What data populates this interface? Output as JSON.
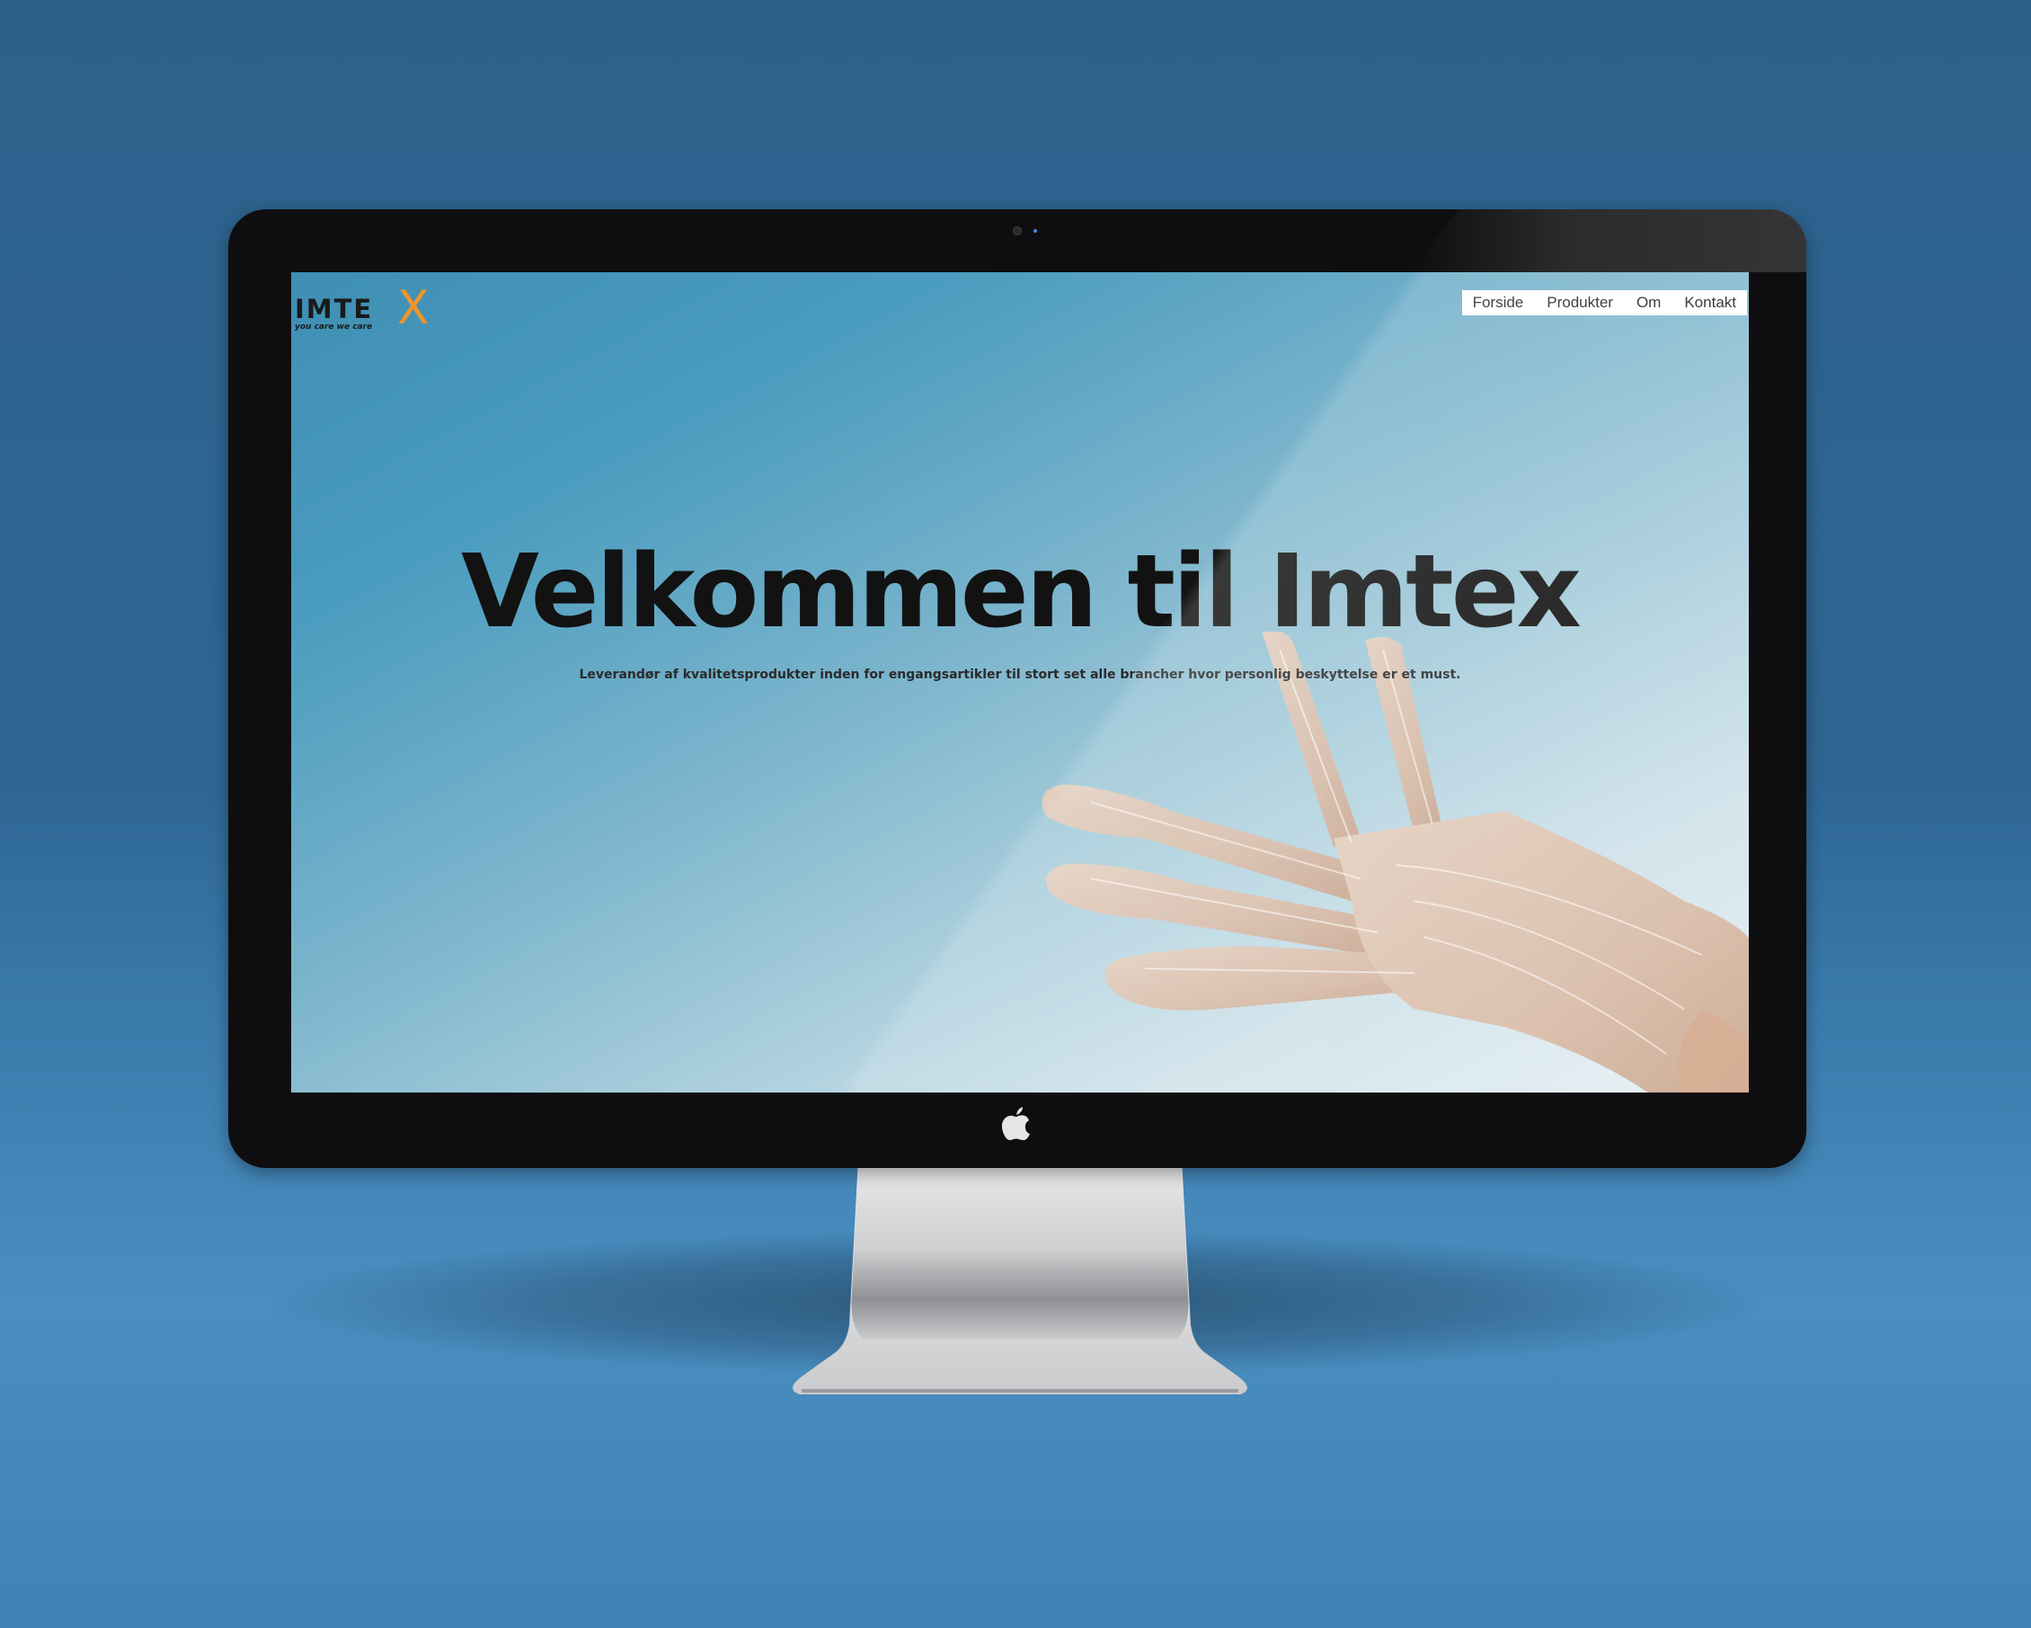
{
  "site": {
    "logo": {
      "wordmark": "IMTE",
      "mark": "X",
      "tagline": "you care we care",
      "accent_color": "#f0932b"
    },
    "nav": {
      "items": [
        "Forside",
        "Produkter",
        "Om",
        "Kontakt"
      ]
    },
    "hero": {
      "title": "Velkommen til Imtex",
      "subtitle": "Leverandør af kvalitetsprodukter inden for engangsartikler til stort set alle brancher hvor personlig beskyttelse er et must."
    }
  },
  "device": {
    "brand_icon": "apple-logo-icon"
  },
  "colors": {
    "background": "#2e6693",
    "bezel": "#0e0e10",
    "screen_top": "#3f8fb4",
    "screen_bottom": "#e8f1f4"
  }
}
